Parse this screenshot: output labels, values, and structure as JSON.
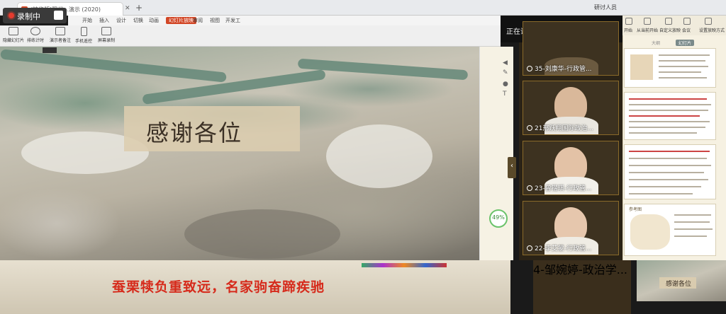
{
  "recorder": {
    "label": "录制中"
  },
  "browser": {
    "tabs": [
      {
        "title": "(精华版)现代...演示 (2020)"
      }
    ],
    "new_tab": "+",
    "close": "✕",
    "account": "研讨人员"
  },
  "ribbon": {
    "menu": [
      "开始",
      "插入",
      "设计",
      "切换",
      "动画",
      "幻灯片放映",
      "审阅",
      "视图",
      "开发工"
    ],
    "active_menu": "幻灯片放映",
    "buttons": [
      "隐藏幻灯片",
      "排练计时",
      "演示者备注",
      "手机遥控",
      "屏幕录制"
    ]
  },
  "slide": {
    "title": "感谢各位",
    "motto": "蚕栗犊负重致远，名家驹奋蹄疾驰"
  },
  "timer": {
    "value": "49",
    "unit": "%"
  },
  "meeting": {
    "speaking": "正在讲话: 马雪松",
    "participants": [
      {
        "name": "35-刘康华-行政管..."
      },
      {
        "name": "21邢跃翔国际政治..."
      },
      {
        "name": "23-曾锴琪-行政管..."
      },
      {
        "name": "22-李艾蒙-行政管..."
      },
      {
        "name": "4-邹婉婷-政治学..."
      }
    ]
  },
  "right_panel": {
    "toolbar": [
      "开始",
      "从当前开始",
      "自定义放映",
      "会议",
      "设置放映方式"
    ],
    "tabs": [
      "大纲",
      "幻灯片"
    ],
    "active_tab": "幻灯片",
    "thumb_title": "感谢各位",
    "section_label": "参考图"
  },
  "colors": {
    "accent": "#d24726",
    "motto": "#d62a1b",
    "panel": "#2b2316",
    "tile_border": "#8a6a2a"
  }
}
